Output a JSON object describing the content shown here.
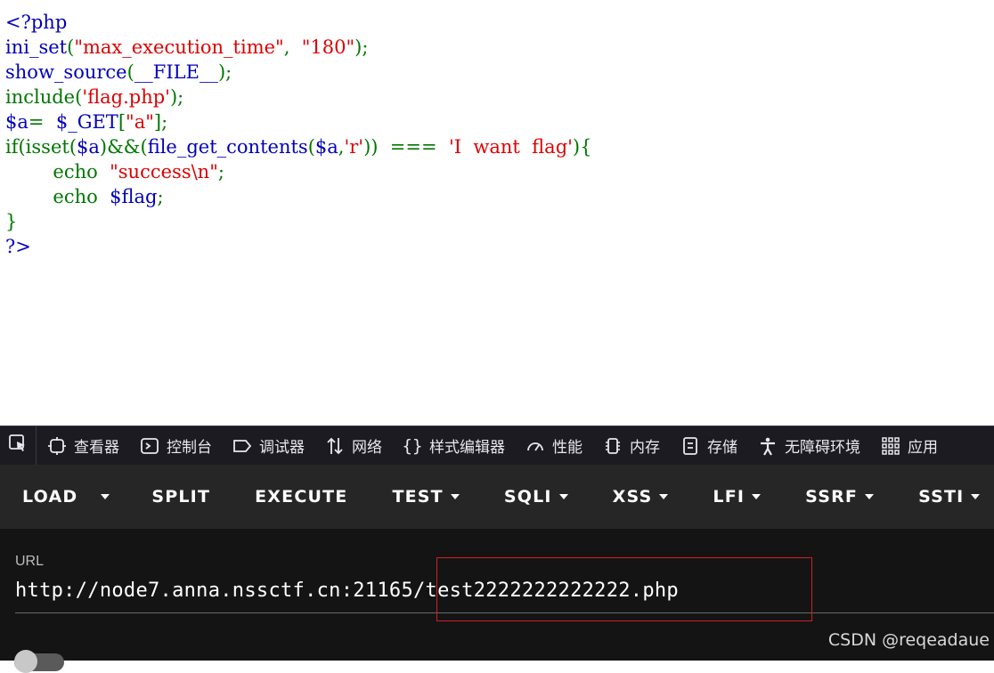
{
  "source": {
    "open_tag": "<?php",
    "l2": {
      "fn": "ini_set",
      "open": "(",
      "arg1": "\"max_execution_time\"",
      "comma": ",  ",
      "arg2": "\"180\"",
      "close": ");"
    },
    "l3": {
      "fn": "show_source",
      "open": "(",
      "arg": "__FILE__",
      "close": ");"
    },
    "l4": {
      "fn": "include",
      "open": "(",
      "arg": "'flag.php'",
      "close": ");"
    },
    "l5": {
      "var": "$a",
      "eq": "=  ",
      "get": "$_GET",
      "open": "[",
      "key": "\"a\"",
      "close": "];"
    },
    "l6": {
      "kw": "if(isset(",
      "var1": "$a",
      "mid": ")&&(",
      "fn": "file_get_contents",
      "open": "(",
      "var2": "$a",
      "comma": ",",
      "mode": "'r'",
      "cmp": "))  ===  ",
      "cmpstr": "'I  want  flag'",
      "end": "){"
    },
    "l7": {
      "indent": "        ",
      "kw": "echo  ",
      "str": "\"success\\n\"",
      "end": ";"
    },
    "l8": {
      "indent": "        ",
      "kw": "echo  ",
      "var": "$flag",
      "end": ";"
    },
    "l9": "}",
    "close_tag": "?>"
  },
  "devtools": {
    "tabs": [
      {
        "icon": "inspector-icon",
        "label": "查看器"
      },
      {
        "icon": "console-icon",
        "label": "控制台"
      },
      {
        "icon": "debugger-icon",
        "label": "调试器"
      },
      {
        "icon": "network-icon",
        "label": "网络"
      },
      {
        "icon": "style-editor-icon",
        "label": "样式编辑器"
      },
      {
        "icon": "performance-icon",
        "label": "性能"
      },
      {
        "icon": "memory-icon",
        "label": "内存"
      },
      {
        "icon": "storage-icon",
        "label": "存储"
      },
      {
        "icon": "accessibility-icon",
        "label": "无障碍环境"
      },
      {
        "icon": "apps-icon",
        "label": "应用"
      }
    ]
  },
  "hackbar": {
    "load": "LOAD",
    "split": "SPLIT",
    "execute": "EXECUTE",
    "test": "TEST",
    "sqli": "SQLI",
    "xss": "XSS",
    "lfi": "LFI",
    "ssrf": "SSRF",
    "ssti": "SSTI"
  },
  "url": {
    "label": "URL",
    "value": "http://node7.anna.nssctf.cn:21165/test2222222222222.php"
  },
  "watermark": "CSDN @reqeadaue",
  "colors": {
    "keyword": "#007700",
    "string": "#dd0000",
    "default": "#0000bb",
    "highlight_box": "#d02020"
  }
}
